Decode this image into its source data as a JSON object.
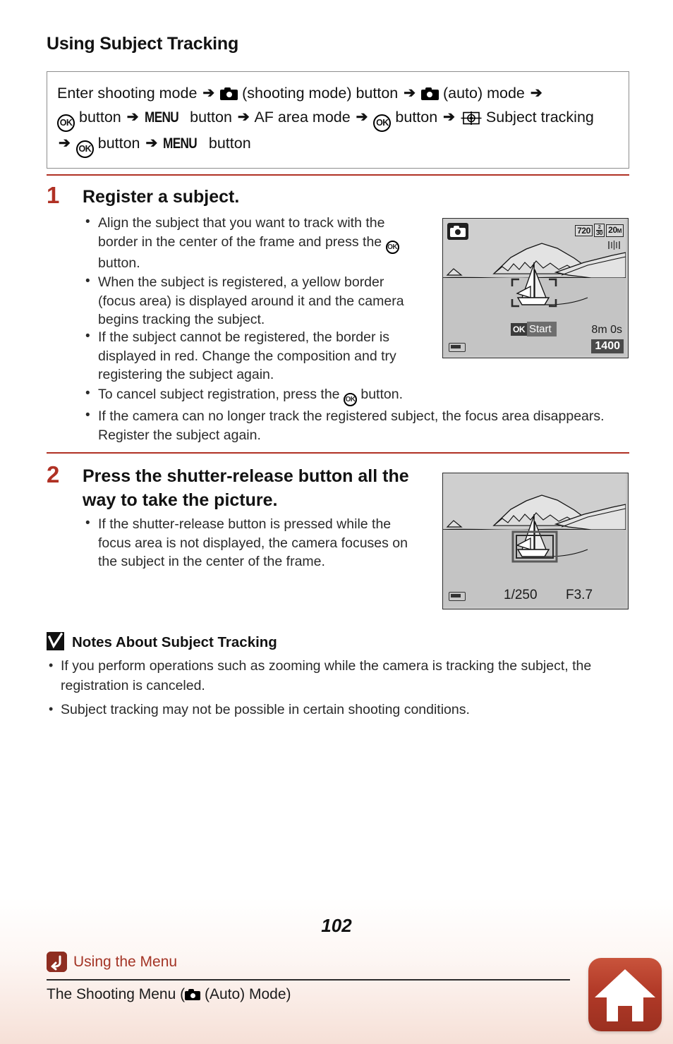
{
  "document": {
    "title": "Using Subject Tracking",
    "page_number": "102"
  },
  "breadcrumb": {
    "line1_a": "Enter shooting mode",
    "line1_b": "(shooting mode) button",
    "line1_c": "(auto) mode",
    "line2_a": "button",
    "line2_menu": "MENU",
    "line2_b": "button",
    "line2_c": "AF area mode",
    "line2_d": "button",
    "line2_e": "Subject tracking",
    "line3_a": "button",
    "line3_menu": "MENU",
    "line3_b": "button",
    "arrow": "➔",
    "ok_label": "OK",
    "icons": {
      "camera": "camera-icon",
      "ok_button": "ok-button-icon",
      "menu_button": "menu-button-icon",
      "subject_tracking": "subject-tracking-icon"
    }
  },
  "steps": [
    {
      "number": "1",
      "heading": "Register a subject.",
      "bullets": [
        {
          "pre": "Align the subject that you want to track with the border in the center of the frame and press the ",
          "icon": "OK",
          "post": " button."
        },
        {
          "pre": "When the subject is registered, a yellow border (focus area) is displayed around it and the camera begins tracking the subject.",
          "icon": null,
          "post": ""
        },
        {
          "pre": "If the subject cannot be registered, the border is displayed in red. Change the composition and try registering the subject again.",
          "icon": null,
          "post": ""
        },
        {
          "pre": "To cancel subject registration, press the ",
          "icon": "OK",
          "post": " button."
        },
        {
          "pre": "If the camera can no longer track the registered subject, the focus area disappears. Register the subject again.",
          "icon": null,
          "post": ""
        }
      ]
    },
    {
      "number": "2",
      "heading": "Press the shutter-release button all the way to take the picture.",
      "bullets": [
        {
          "pre": "If the shutter-release button is pressed while the focus area is not displayed, the camera focuses on the subject in the center of the frame.",
          "icon": null,
          "post": ""
        }
      ]
    }
  ],
  "lcd_screens": [
    {
      "name": "register-subject-screen",
      "mode_badge": "camera-mode-icon",
      "movie_size": "720",
      "frame_rate_top": "2",
      "frame_rate_bottom": "30",
      "image_size": "20",
      "image_size_unit": "M",
      "vr_icon": "vibration-reduction-icon",
      "ok_tag": "OK",
      "action_label": "Start",
      "movie_time": "8m  0s",
      "shots_remaining": "1400",
      "battery": "battery-icon"
    },
    {
      "name": "take-picture-screen",
      "shutter_speed": "1/250",
      "aperture": "F3.7",
      "battery": "battery-icon"
    }
  ],
  "notes": {
    "icon": "caution-check-icon",
    "heading": "Notes About Subject Tracking",
    "items": [
      "If you perform operations such as zooming while the camera is tracking the subject, the registration is canceled.",
      "Subject tracking may not be possible in certain shooting conditions."
    ]
  },
  "footer": {
    "section_link": "Using the Menu",
    "section_link_icon": "back-arrow-icon",
    "breadcrumb_pre": "The Shooting Menu (",
    "breadcrumb_post": " (Auto) Mode)",
    "home_icon": "home-icon"
  },
  "colors": {
    "accent_red": "#b03124",
    "link_red": "#a33425",
    "badge_red": "#8e2d21",
    "lcd_bg": "#c8c8c8",
    "text": "#1a1a1a"
  }
}
